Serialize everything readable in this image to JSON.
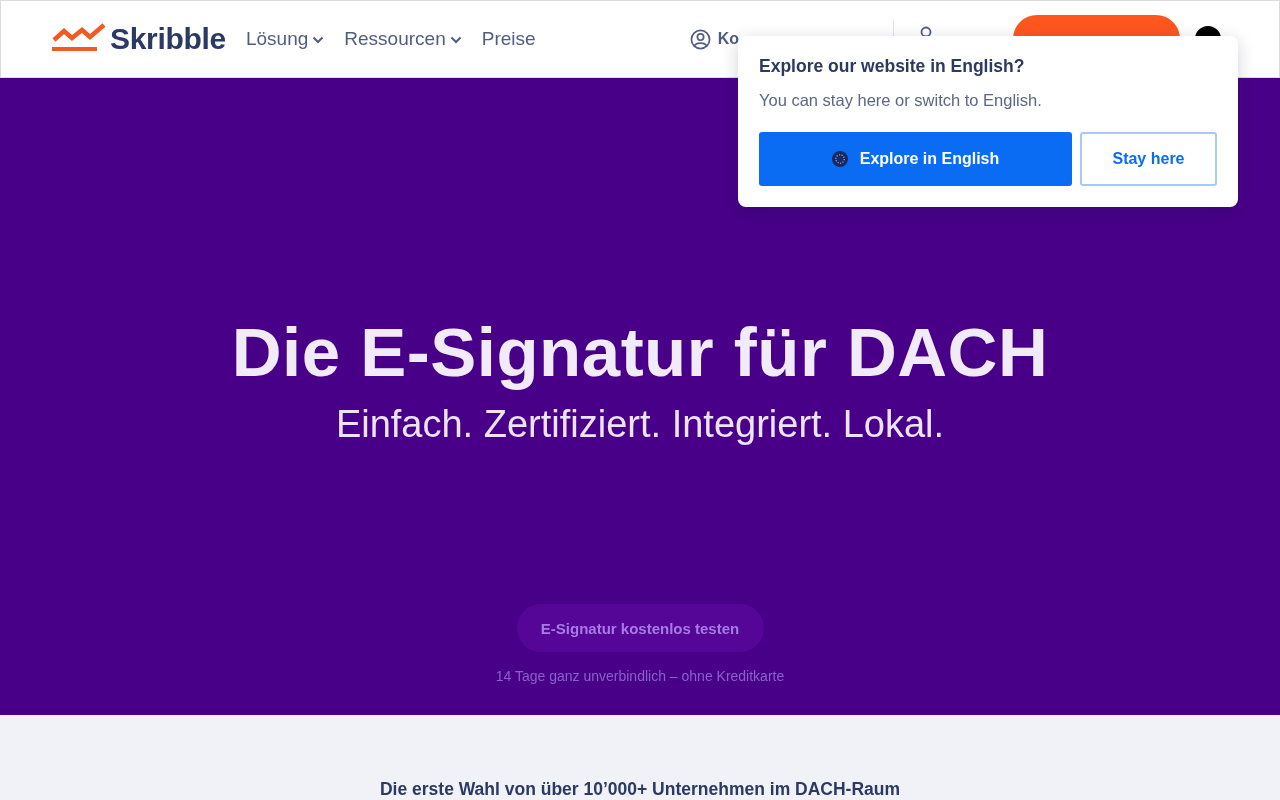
{
  "header": {
    "logo": {
      "text": "Skribble"
    },
    "nav": [
      {
        "label": "Lösung",
        "kind": "dropdown"
      },
      {
        "label": "Ressourcen",
        "kind": "dropdown"
      },
      {
        "label": "Preise",
        "kind": "link"
      }
    ],
    "contact_link": {
      "label": "Ko"
    }
  },
  "language_popup": {
    "title": "Explore our website in English?",
    "message": "You can stay here or switch to English.",
    "buttons": [
      {
        "label": "Explore in English",
        "kind": "primary"
      },
      {
        "label": "Stay here",
        "kind": "secondary"
      }
    ]
  },
  "hero": {
    "title": "Die E-Signatur für DACH",
    "subtitle": "Einfach. Zertifiziert. Integriert. Lokal.",
    "cta_button": {
      "label": "E-Signatur kostenlos testen"
    },
    "note": "14 Tage ganz unverbindlich – ohne Kreditkarte"
  },
  "trust_section": {
    "heading": "Die erste Wahl von über 10’000+ Unternehmen im DACH-Raum"
  }
}
